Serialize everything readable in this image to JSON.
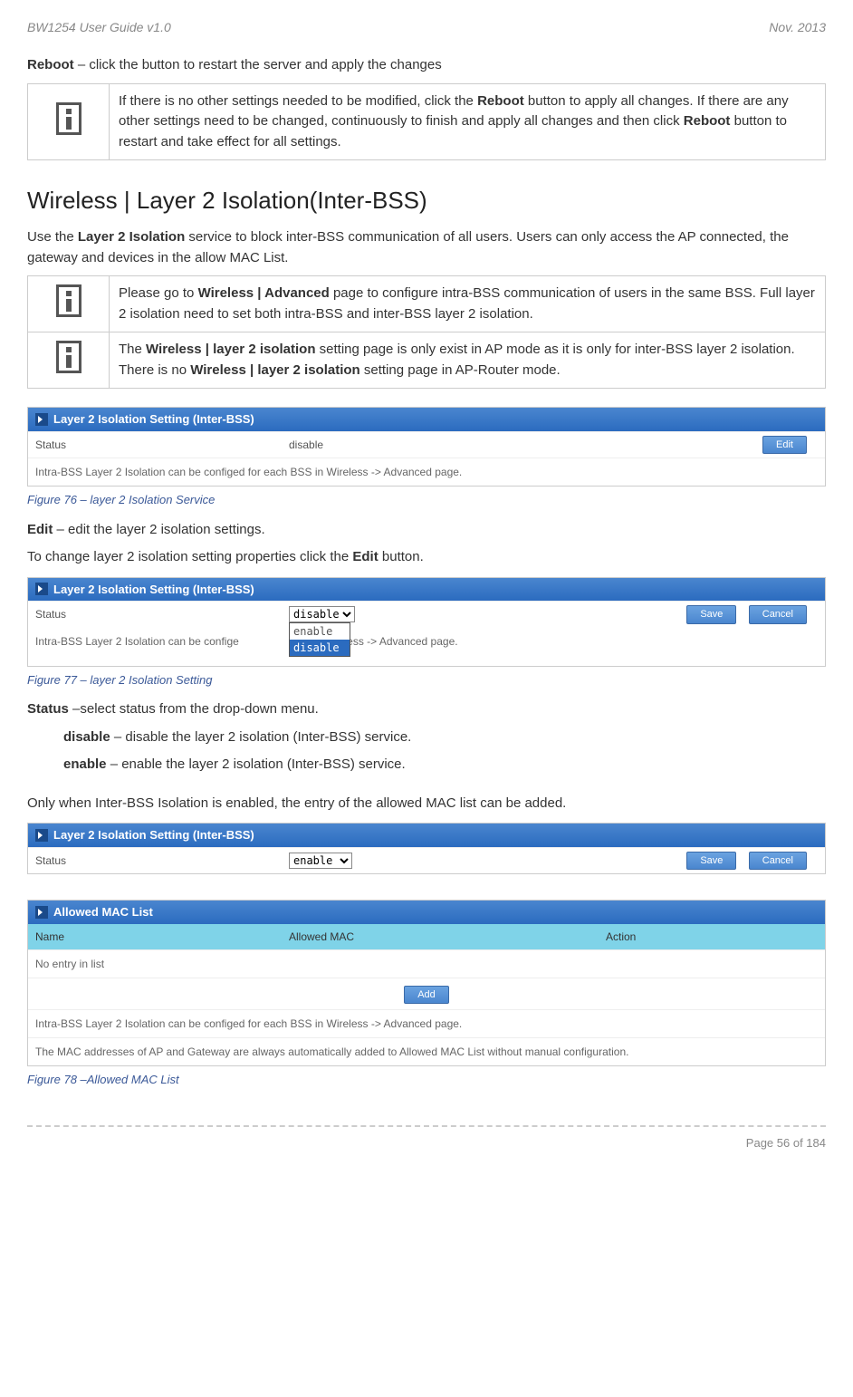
{
  "header": {
    "left": "BW1254 User Guide v1.0",
    "right": "Nov.  2013"
  },
  "reboot_line": {
    "prefix": "Reboot",
    "text": " – click the button to restart the server and apply the changes"
  },
  "reboot_info_box": "If there is no other settings needed to be modified, click the Reboot button to apply all changes. If there are any other settings need to be changed, continuously to finish and apply all changes and then click Reboot button to restart and take effect  for all settings.",
  "reboot_info_box_html": "If there is no other settings needed to be modified, click the <span class='bold'>Reboot</span> button to apply all changes. If there are any other settings need to be changed, continuously to finish and apply all changes and then click <span class='bold'>Reboot</span> button to restart and take effect  for all settings.",
  "section_title": "Wireless | Layer 2 Isolation(Inter-BSS)",
  "intro_html": "Use the <span class='bold'>Layer 2 Isolation</span> service to block inter-BSS communication of all users. Users can only access the AP connected, the gateway and devices in the allow MAC List.",
  "notes": [
    "Please go to <span class='bold'>Wireless | Advanced</span> page to configure intra-BSS communication of users in the same BSS. Full layer 2 isolation need to set both intra-BSS and inter-BSS layer 2 isolation.",
    "The <span class='bold'>Wireless | layer 2 isolation</span> setting page is only exist in AP mode as it is only for inter-BSS layer 2 isolation. There is no <span class='bold'>Wireless | layer 2 isolation</span> setting page in AP-Router mode."
  ],
  "fig76": {
    "title": "Layer 2 Isolation Setting (Inter-BSS)",
    "status_label": "Status",
    "status_value": "disable",
    "edit_btn": "Edit",
    "note": "Intra-BSS Layer 2 Isolation can be configed for each BSS in Wireless -> Advanced page.",
    "caption": "Figure 76 – layer 2 Isolation Service"
  },
  "edit_line_html": "<span class='bold'>Edit</span> – edit the layer 2 isolation settings.",
  "change_line_html": "To change layer 2 isolation setting properties click the <span class='bold'>Edit</span> button.",
  "fig77": {
    "title": "Layer 2 Isolation Setting (Inter-BSS)",
    "status_label": "Status",
    "selected": "disable",
    "options": [
      "enable",
      "disable"
    ],
    "save_btn": "Save",
    "cancel_btn": "Cancel",
    "note_partial_left": "Intra-BSS Layer 2 Isolation can be confige",
    "note_partial_right": "SS in Wireless -> Advanced page.",
    "caption": "Figure 77 – layer 2 Isolation Setting"
  },
  "status_line_html": "<span class='bold'>Status</span> –select status from the drop-down menu.",
  "disable_line_html": "<span class='bold'>disable</span> – disable the layer 2 isolation (Inter-BSS) service.",
  "enable_line_html": "<span class='bold'>enable</span> – enable the layer 2 isolation (Inter-BSS) service.",
  "only_when_line": "Only when Inter-BSS Isolation is enabled, the entry of the allowed MAC list can be added.",
  "fig78": {
    "top_title": "Layer 2 Isolation Setting (Inter-BSS)",
    "status_label": "Status",
    "status_value": "enable",
    "save_btn": "Save",
    "cancel_btn": "Cancel",
    "mac_title": "Allowed MAC List",
    "headers": [
      "Name",
      "Allowed MAC",
      "Action"
    ],
    "empty_row": "No entry in list",
    "add_btn": "Add",
    "note1": "Intra-BSS Layer 2 Isolation can be configed for each BSS in Wireless -> Advanced page.",
    "note2": "The MAC addresses of AP and Gateway are always automatically added to Allowed MAC List without manual configuration.",
    "caption": "Figure 78 –Allowed MAC List"
  },
  "footer": "Page 56 of 184"
}
